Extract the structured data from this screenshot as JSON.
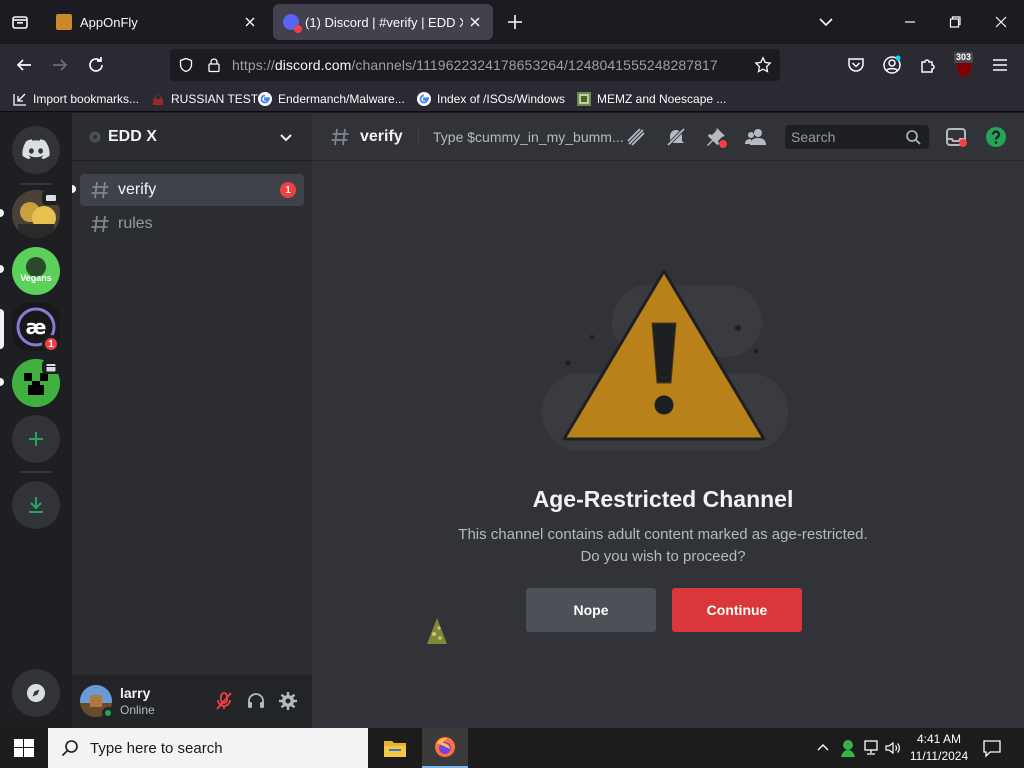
{
  "browser": {
    "tabs": [
      {
        "title": "AppOnFly",
        "active": false
      },
      {
        "title": "(1) Discord | #verify | EDD X",
        "active": true
      }
    ],
    "url_prefix": "https://",
    "url_host": "discord.com",
    "url_path": "/channels/1119622324178653264/1248041555248287817",
    "extension_badge": "303",
    "bookmarks": [
      {
        "label": "Import bookmarks...",
        "icon": "import-icon"
      },
      {
        "label": "RUSSIAN TEST",
        "icon": "red-hat-icon"
      },
      {
        "label": "Endermanch/Malware...",
        "icon": "google-icon"
      },
      {
        "label": "Index of /ISOs/Windows",
        "icon": "google-icon"
      },
      {
        "label": "MEMZ and Noescape ...",
        "icon": "image-icon"
      }
    ]
  },
  "discord": {
    "server_name": "EDD X",
    "channels": [
      {
        "name": "verify",
        "active": true,
        "badge": "1"
      },
      {
        "name": "rules",
        "active": false,
        "badge": ""
      }
    ],
    "guild_badge": "1",
    "header": {
      "channel_name": "verify",
      "topic": "Type $cummy_in_my_bumm...",
      "search_placeholder": "Search"
    },
    "notice": {
      "title": "Age-Restricted Channel",
      "line1": "This channel contains adult content marked as age-restricted.",
      "line2": "Do you wish to proceed?",
      "nope_label": "Nope",
      "continue_label": "Continue"
    },
    "user": {
      "name": "larry",
      "status": "Online"
    }
  },
  "taskbar": {
    "search_placeholder": "Type here to search",
    "time": "4:41 AM",
    "date": "11/11/2024"
  },
  "colors": {
    "discord_blurple": "#5865f2",
    "danger_red": "#da373c",
    "online_green": "#23a55a",
    "warning_fill": "#b8811a",
    "badge_red": "#f23f43"
  }
}
